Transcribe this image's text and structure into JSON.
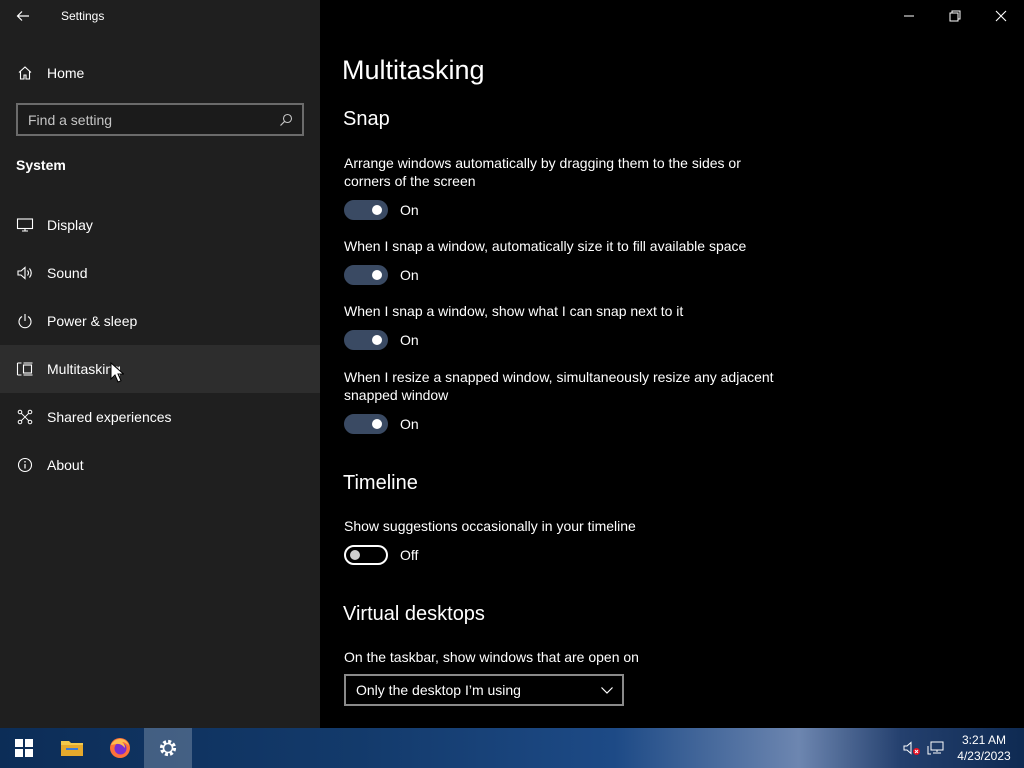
{
  "window": {
    "title": "Settings"
  },
  "sidebar": {
    "home_label": "Home",
    "search_placeholder": "Find a setting",
    "section_label": "System",
    "items": [
      {
        "label": "Display",
        "icon": "display-icon"
      },
      {
        "label": "Sound",
        "icon": "speaker-icon"
      },
      {
        "label": "Power & sleep",
        "icon": "power-icon"
      },
      {
        "label": "Multitasking",
        "icon": "multitasking-icon",
        "selected": true
      },
      {
        "label": "Shared experiences",
        "icon": "shared-experiences-icon"
      },
      {
        "label": "About",
        "icon": "info-icon"
      }
    ]
  },
  "main": {
    "page_title": "Multitasking",
    "snap": {
      "title": "Snap",
      "settings": [
        {
          "desc": "Arrange windows automatically by dragging them to the sides or corners of the screen",
          "state": "On"
        },
        {
          "desc": "When I snap a window, automatically size it to fill available space",
          "state": "On"
        },
        {
          "desc": "When I snap a window, show what I can snap next to it",
          "state": "On"
        },
        {
          "desc": "When I resize a snapped window, simultaneously resize any adjacent snapped window",
          "state": "On"
        }
      ]
    },
    "timeline": {
      "title": "Timeline",
      "desc": "Show suggestions occasionally in your timeline",
      "state": "Off"
    },
    "virtual_desktops": {
      "title": "Virtual desktops",
      "desc": "On the taskbar, show windows that are open on",
      "selected": "Only the desktop I’m using"
    }
  },
  "taskbar": {
    "apps": [
      "start-icon",
      "file-explorer-icon",
      "firefox-icon",
      "settings-icon"
    ],
    "active_app": "settings-icon",
    "time": "3:21 AM",
    "date": "4/23/2023"
  },
  "colors": {
    "sidebar_bg": "#1f1f1f",
    "main_bg": "#000000",
    "toggle_on": "#3a4a63",
    "selected_bg": "#2d2d2d"
  }
}
